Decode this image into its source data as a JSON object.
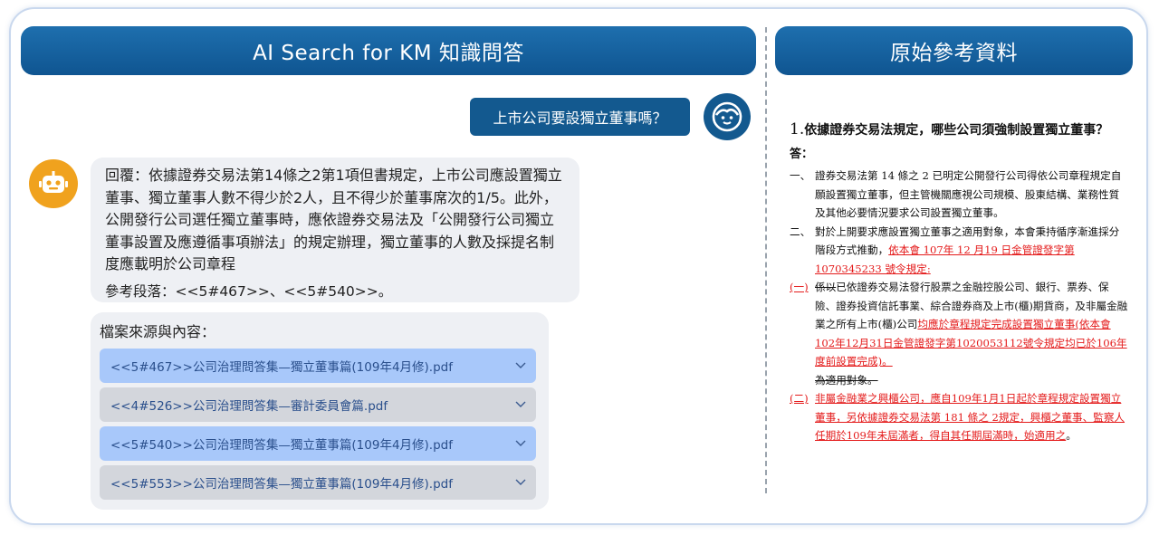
{
  "header": {
    "left_title": "AI Search for KM 知識問答",
    "right_title": "原始參考資料"
  },
  "chat": {
    "user_question": "上市公司要設獨立董事嗎？",
    "answer_text": "回覆：依據證券交易法第14條之2第1項但書規定，上市公司應設置獨立董事、獨立董事人數不得少於2人，且不得少於董事席次的1/5。此外，公開發行公司選任獨立董事時，應依證券交易法及「公開發行公司獨立董事設置及應遵循事項辦法」的規定辦理，獨立董事的人數及採提名制度應載明於公司章程",
    "reference_text": "參考段落：<<5#467>>、<<5#540>>。"
  },
  "sources": {
    "title": "檔案來源與內容：",
    "items": [
      {
        "label": "<<5#467>>公司治理問答集—獨立董事篇(109年4月修).pdf",
        "highlighted": true
      },
      {
        "label": "<<4#526>>公司治理問答集—審計委員會篇.pdf",
        "highlighted": false
      },
      {
        "label": "<<5#540>>公司治理問答集—獨立董事篇(109年4月修).pdf",
        "highlighted": true
      },
      {
        "label": "<<5#553>>公司治理問答集—獨立董事篇(109年4月修).pdf",
        "highlighted": false
      }
    ]
  },
  "reference_doc": {
    "question_number": "1.",
    "question": "依據證券交易法規定，哪些公司須強制設置獨立董事？",
    "answer_label": "答：",
    "p1_marker": "一、",
    "p1_text": "證券交易法第 14 條之 2 已明定公開發行公司得依公司章程規定自願設置獨立董事，但主管機關應視公司規模、股東結構、業務性質及其他必要情況要求公司設置獨立董事。",
    "p2_marker": "二、",
    "p2_text": "對於上開要求應設置獨立董事之適用對象，本會秉持循序漸進採分階段方式推動，",
    "p2_red": "依本會 107年 12 月19 日金管證發字第 1070345233 號令規定:",
    "p3_marker": "(一)",
    "p3_strike": "係以",
    "p3_text": "已依證券交易法發行股票之金融控股公司、銀行、票券、保險、證券投資信託事業、綜合證券商及上市(櫃)期貨商，及非屬金融業之所有上市(櫃)公司",
    "p3_red": "均應於章程規定完成設置獨立董事(依本會102年12月31日金管證發字第1020053112號令規定均已於106年度前設置完成)。",
    "p3_strike_tail": "為適用對象。",
    "p4_marker": "(二)",
    "p4_red": "非屬金融業之興櫃公司，應自109年1月1日起於章程規定設置獨立董事，另依據證券交易法第 181 條之 2規定，興櫃之董事、監察人任期於109年未屆滿者，得自其任期屆滿時，始適用之",
    "p4_tail": "。"
  },
  "colors": {
    "header_blue": "#13598f",
    "bot_avatar": "#f0a21e",
    "source_highlight": "#a8c8fa",
    "source_normal": "#d3d6dc",
    "revision_red": "#e41b1b"
  }
}
